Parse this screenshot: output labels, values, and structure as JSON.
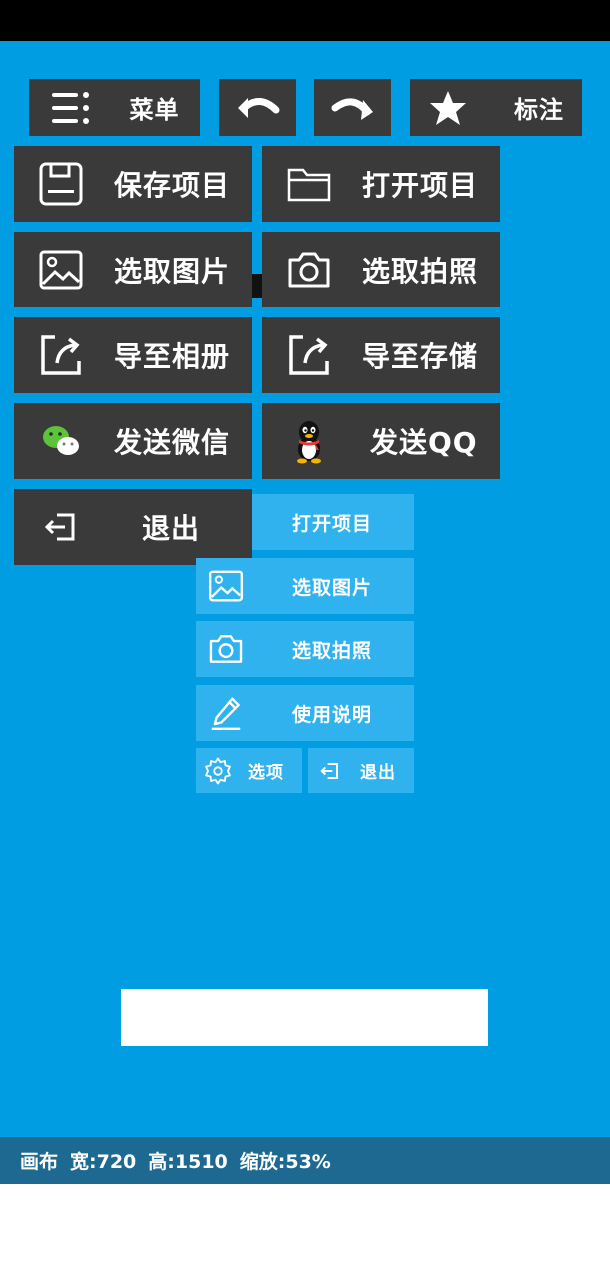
{
  "toolbar": {
    "menu_label": "菜单",
    "annotate_label": "标注"
  },
  "dropdown_menu": {
    "items": [
      {
        "label": "保存项目",
        "icon": "save-icon"
      },
      {
        "label": "打开项目",
        "icon": "folder-icon"
      },
      {
        "label": "选取图片",
        "icon": "image-icon"
      },
      {
        "label": "选取拍照",
        "icon": "camera-icon"
      },
      {
        "label": "导至相册",
        "icon": "export-icon"
      },
      {
        "label": "导至存储",
        "icon": "export-icon"
      },
      {
        "label": "发送微信",
        "icon": "wechat-icon"
      },
      {
        "label": "发送QQ",
        "icon": "qq-icon"
      },
      {
        "label": "退出",
        "icon": "exit-icon"
      }
    ]
  },
  "start_menu": {
    "items": [
      {
        "label": "打开项目"
      },
      {
        "label": "选取图片",
        "icon": "image-icon"
      },
      {
        "label": "选取拍照",
        "icon": "camera-icon"
      },
      {
        "label": "使用说明",
        "icon": "pen-icon"
      }
    ],
    "options_label": "选项",
    "exit_label": "退出"
  },
  "info_bar": {
    "canvas_label": "画布",
    "width_text": "宽:720",
    "height_text": "高:1510",
    "zoom_text": "缩放:53%"
  },
  "colors": {
    "canvas_bg": "#019de3",
    "menu_bg": "#3a3a3a",
    "start_item_bg": "#30b2ee",
    "info_bar_bg": "#1d6991"
  }
}
